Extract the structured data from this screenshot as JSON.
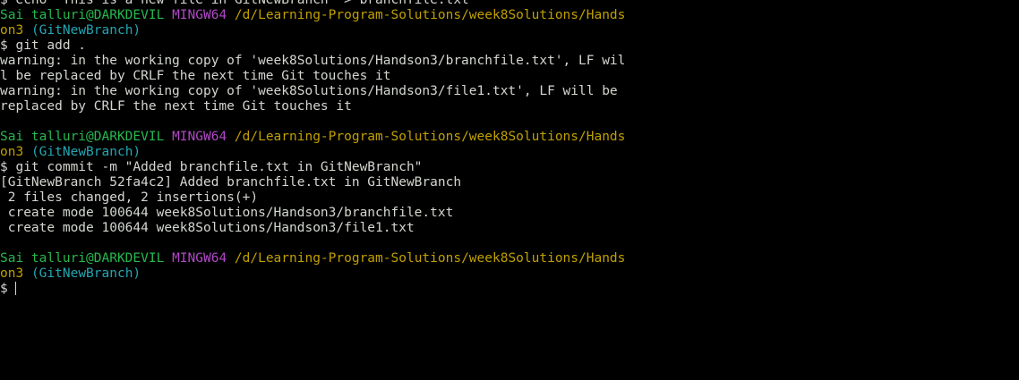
{
  "terminal": {
    "partial_top_line": "$ echo \"This is a new file in GitNewBranch\" > branchfile.txt",
    "prompt": {
      "user_host": "Sai talluri@DARKDEVIL",
      "system": "MINGW64",
      "path_part1": "/d/Learning-Program-Solutions/week8Solutions/Hands",
      "path_part2": "on3",
      "branch": "(GitNewBranch)",
      "symbol": "$"
    },
    "block1": {
      "command": "git add .",
      "out1": "warning: in the working copy of 'week8Solutions/Handson3/branchfile.txt', LF wil",
      "out2": "l be replaced by CRLF the next time Git touches it",
      "out3": "warning: in the working copy of 'week8Solutions/Handson3/file1.txt', LF will be",
      "out4": "replaced by CRLF the next time Git touches it"
    },
    "block2": {
      "command": "git commit -m \"Added branchfile.txt in GitNewBranch\"",
      "out1": "[GitNewBranch 52fa4c2] Added branchfile.txt in GitNewBranch",
      "out2": " 2 files changed, 2 insertions(+)",
      "out3": " create mode 100644 week8Solutions/Handson3/branchfile.txt",
      "out4": " create mode 100644 week8Solutions/Handson3/file1.txt"
    }
  }
}
